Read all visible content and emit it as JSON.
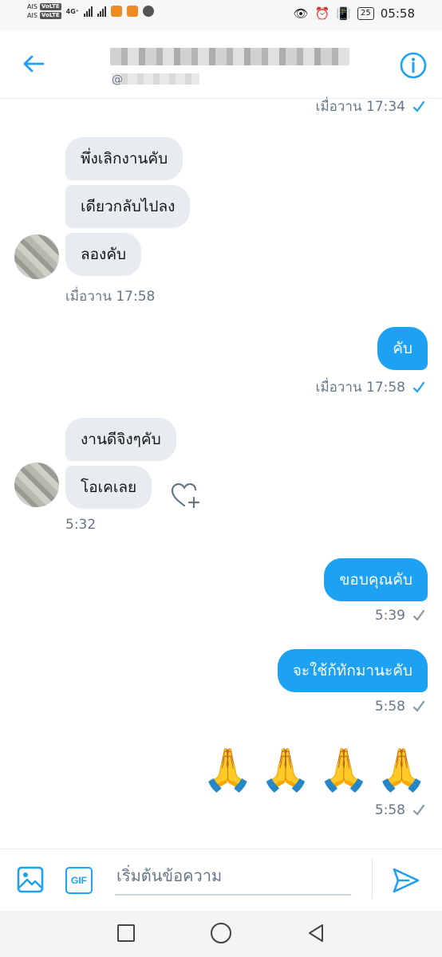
{
  "status_bar": {
    "carrier_top": "AIS",
    "carrier_bottom": "AIS",
    "volte": "VoLTE",
    "network": "4G⁺",
    "battery": "25",
    "time": "05:58"
  },
  "header": {
    "back_icon": "arrow-left-icon",
    "info_icon": "info-circle-icon",
    "name_blurred": true,
    "handle_prefix": "@"
  },
  "messages": {
    "top_meta": "เมื่อวาน 17:34",
    "group1": {
      "bubbles": [
        "พึ่งเลิกงานคับ",
        "เดียวกลับไปลง",
        "ลองคับ"
      ],
      "time": "เมื่อวาน 17:58"
    },
    "out1": {
      "text": "คับ",
      "time": "เมื่อวาน 17:58"
    },
    "group2": {
      "bubbles": [
        "งานดีจิงๆคับ",
        "โอเคเลย"
      ],
      "time": "5:32"
    },
    "out2": {
      "text": "ขอบคุณคับ",
      "time": "5:39"
    },
    "out3": {
      "text": "จะใช้ก้ทักมานะคับ",
      "time": "5:58"
    },
    "out4": {
      "emoji": [
        "🙏",
        "🙏",
        "🙏",
        "🙏"
      ],
      "time": "5:58"
    }
  },
  "composer": {
    "placeholder": "เริ่มต้นข้อความ",
    "gif_label": "GIF"
  },
  "colors": {
    "accent": "#1da1f2",
    "incoming_bubble": "#e6ecf0",
    "meta_text": "#657786"
  }
}
